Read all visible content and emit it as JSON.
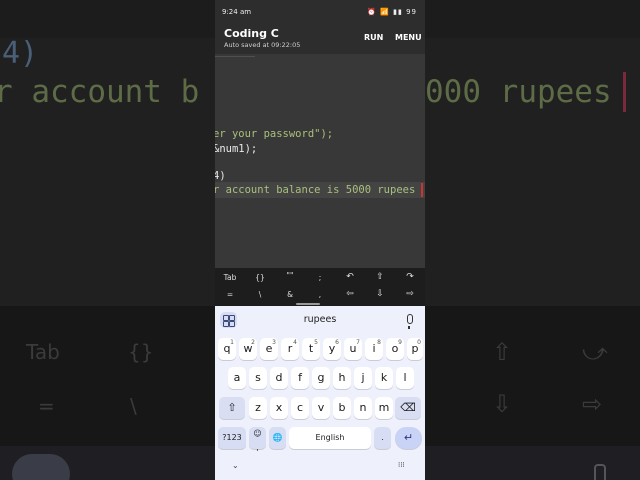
{
  "background": {
    "paren": "4)",
    "balance_left": "r account b",
    "balance_right": "000 rupees",
    "toolbar_keys": [
      "Tab",
      "{}",
      "⇧",
      "⤻",
      "=",
      "\\",
      "⇩",
      "⇨"
    ]
  },
  "status_bar": {
    "time": "9:24 am",
    "icons_text": "⏰ 📶 ▮▮ 99"
  },
  "app_bar": {
    "title": "Coding C",
    "subtitle": "Auto saved at 09:22:05",
    "run_label": "RUN",
    "menu_label": "MENU"
  },
  "code": {
    "lines": [
      {
        "text": "er your password\");"
      },
      {
        "text": "&num1);"
      },
      {
        "text": "4)"
      },
      {
        "text": "r account balance is 5000 rupees"
      }
    ]
  },
  "extra_keys": {
    "row1": [
      "Tab",
      "{}",
      "\"\"",
      ";",
      "↶",
      "⇧",
      "↷"
    ],
    "row2": [
      "=",
      "\\",
      "&",
      ",",
      "⇦",
      "⇩",
      "⇨"
    ]
  },
  "keyboard": {
    "suggestion": "rupees",
    "row1": [
      {
        "key": "q",
        "sup": "1"
      },
      {
        "key": "w",
        "sup": "2"
      },
      {
        "key": "e",
        "sup": "3"
      },
      {
        "key": "r",
        "sup": "4"
      },
      {
        "key": "t",
        "sup": "5"
      },
      {
        "key": "y",
        "sup": "6"
      },
      {
        "key": "u",
        "sup": "7"
      },
      {
        "key": "i",
        "sup": "8"
      },
      {
        "key": "o",
        "sup": "9"
      },
      {
        "key": "p",
        "sup": "0"
      }
    ],
    "row2": [
      "a",
      "s",
      "d",
      "f",
      "g",
      "h",
      "j",
      "k",
      "l"
    ],
    "row3": [
      "z",
      "x",
      "c",
      "v",
      "b",
      "n",
      "m"
    ],
    "symbols_label": "?123",
    "emoji_label": "☺",
    "comma_label": ",",
    "space_label": "English",
    "period_label": ".",
    "shift_label": "⇧",
    "backspace_label": "⌫",
    "enter_label": "↵",
    "globe_label": "🌐",
    "nav_down": "⌄",
    "nav_grid": "⁞⁞⁞"
  }
}
